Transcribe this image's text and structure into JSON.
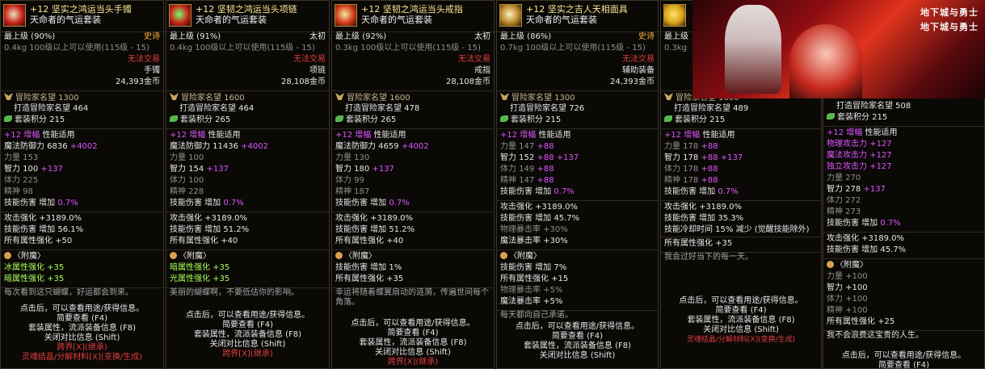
{
  "panels": [
    {
      "id": "bracelet",
      "title": "+12 坚实之鸿运当头手镯",
      "set_name": "天命者的气运套装",
      "grade": "最上级 (90%)",
      "rarity": "史诗",
      "weight": "0.4kg",
      "level_req": "100级以上可以使用(115级 - 15)",
      "trade": "无法交易",
      "slot": "手镯",
      "price": "24,393金币",
      "rep": "冒险家名望 1300",
      "craft_rep": "打造冒险家名望 464",
      "set_score": "套装积分 215",
      "amp_prefix": "+12",
      "amp_label": "增幅",
      "amp_suffix": "性能适用",
      "stats": [
        {
          "t": "魔法防御力 6836 ",
          "v": "+4002"
        },
        {
          "t": "力量 153",
          "v": ""
        },
        {
          "t": "智力 100 ",
          "v": "+137"
        },
        {
          "t": "体力 225",
          "v": ""
        },
        {
          "t": "精神 98",
          "v": ""
        }
      ],
      "skill_dmg": "技能伤害 增加",
      "skill_dmg_pct": "0.7%",
      "effects": [
        "攻击强化 +3189.0%",
        "技能伤害 增加 56.1%",
        "所有属性强化 +50"
      ],
      "enchant": "〈附魔〉",
      "enchant_effects": [
        "冰属性强化 +35",
        "暗属性强化 +35"
      ],
      "flavor": "每次看到这只蝴蝶，好运都会到来。",
      "footer": [
        "点击后，可以查看用途/获得信息。",
        "简要查看 (F4)",
        "套装属性，流派装备信息 (F8)",
        "关闭对比信息 (Shift)",
        "跨界[X](继承)",
        "灵魂结晶/分解材料[X](变换/生成)"
      ]
    },
    {
      "id": "necklace",
      "title": "+12 坚韧之鸿运当头项链",
      "set_name": "天命者的气运套装",
      "grade": "最上级 (91%)",
      "rarity": "太初",
      "weight": "0.4kg",
      "level_req": "100级以上可以使用(115级 - 15)",
      "trade": "无法交易",
      "slot": "项链",
      "price": "28,108金币",
      "rep": "冒险家名望 1600",
      "craft_rep": "打造冒险家名望 464",
      "set_score": "套装积分 265",
      "amp_prefix": "+12",
      "amp_label": "增幅",
      "amp_suffix": "性能适用",
      "stats": [
        {
          "t": "魔法防御力 11436 ",
          "v": "+4002"
        },
        {
          "t": "力量 100",
          "v": ""
        },
        {
          "t": "智力 154 ",
          "v": "+137"
        },
        {
          "t": "体力 100",
          "v": ""
        },
        {
          "t": "精神 228",
          "v": ""
        }
      ],
      "skill_dmg": "技能伤害 增加",
      "skill_dmg_pct": "0.7%",
      "effects": [
        "攻击强化 +3189.0%",
        "技能伤害 增加 51.2%",
        "所有属性强化 +40"
      ],
      "enchant": "〈附魔〉",
      "enchant_effects": [
        "暗属性强化 +35",
        "光属性强化 +35"
      ],
      "flavor": "美丽的蝴蝶啊，不要低估你的影响。",
      "footer": [
        "点击后，可以查看用途/获得信息。",
        "简要查看 (F4)",
        "套装属性，流派装备信息 (F8)",
        "关闭对比信息 (Shift)",
        "跨界[X](继承)"
      ]
    },
    {
      "id": "ring",
      "title": "+12 坚韧之鸿运当头戒指",
      "set_name": "天命者的气运套装",
      "grade": "最上级 (92%)",
      "rarity": "太初",
      "weight": "0.3kg",
      "level_req": "100级以上可以使用(115级 - 15)",
      "trade": "无法交易",
      "slot": "戒指",
      "price": "28,108金币",
      "rep": "冒险家名望 1600",
      "craft_rep": "打造冒险家名望 478",
      "set_score": "套装积分 265",
      "amp_prefix": "+12",
      "amp_label": "增幅",
      "amp_suffix": "性能适用",
      "stats": [
        {
          "t": "魔法防御力 4659 ",
          "v": "+4002"
        },
        {
          "t": "力量 130",
          "v": ""
        },
        {
          "t": "智力 180 ",
          "v": "+137"
        },
        {
          "t": "体力 99",
          "v": ""
        },
        {
          "t": "精神 187",
          "v": ""
        }
      ],
      "skill_dmg": "技能伤害 增加",
      "skill_dmg_pct": "0.7%",
      "effects": [
        "攻击强化 +3189.0%",
        "技能伤害 增加 51.2%",
        "所有属性强化 +40"
      ],
      "enchant": "〈附魔〉",
      "enchant_effects": [
        "技能伤害 增加 1%",
        "所有属性强化 +35"
      ],
      "flavor": "幸运将随着蝶翼扇动的涟漪，传遍世间每个角落。",
      "footer": [
        "点击后，可以查看用途/获得信息。",
        "简要查看 (F4)",
        "套装属性，流派装备信息 (F8)",
        "关闭对比信息 (Shift)",
        "跨界[X](继承)"
      ]
    },
    {
      "id": "support",
      "title": "+12 坚实之吉人天相面具",
      "set_name": "天命者的气运套装",
      "grade": "最上级 (86%)",
      "rarity": "史诗",
      "weight": "0.7kg",
      "level_req": "100级以上可以使用(115级 - 15)",
      "trade": "无法交易",
      "slot": "辅助装备",
      "price": "24,393金币",
      "rep": "冒险家名望 1300",
      "craft_rep": "打造冒险家名望 726",
      "set_score": "套装积分 215",
      "amp_prefix": "+12",
      "amp_label": "增幅",
      "amp_suffix": "性能适用",
      "stats": [
        {
          "t": "力量 147 ",
          "v": "+88"
        },
        {
          "t": "智力 152 ",
          "v": "+88 +137"
        },
        {
          "t": "体力 149 ",
          "v": "+88"
        },
        {
          "t": "精神 147 ",
          "v": "+88"
        }
      ],
      "skill_dmg": "技能伤害 增加",
      "skill_dmg_pct": "0.7%",
      "effects": [
        "攻击强化 +3189.0%",
        "技能伤害 增加 45.7%",
        "物理暴击率 +30%",
        "魔法暴击率 +30%"
      ],
      "enchant": "〈附魔〉",
      "enchant_effects": [
        "技能伤害 增加 7%",
        "所有属性强化 +15",
        "物理暴击率 +5%",
        "魔法暴击率 +5%"
      ],
      "flavor": "每天都向自己承诺。",
      "footer": [
        "点击后，可以查看用途/获得信息。",
        "简要查看 (F4)",
        "套装属性，流派装备信息 (F8)",
        "关闭对比信息 (Shift)"
      ]
    },
    {
      "id": "magic-stone",
      "title": "",
      "set_name": "",
      "grade": "最上级",
      "rarity": "",
      "weight": "0.3kg",
      "level_req": "",
      "trade": "",
      "slot": "",
      "price": "",
      "rep": "冒险家名望 1600",
      "craft_rep": "打造冒险家名望 489",
      "set_score": "套装积分 215",
      "amp_prefix": "+12",
      "amp_label": "增幅",
      "amp_suffix": "性能适用",
      "stats": [
        {
          "t": "力量 178 ",
          "v": "+88"
        },
        {
          "t": "智力 178 ",
          "v": "+88 +137"
        },
        {
          "t": "体力 178 ",
          "v": "+88"
        },
        {
          "t": "精神 178 ",
          "v": "+88"
        }
      ],
      "skill_dmg": "技能伤害 增加",
      "skill_dmg_pct": "0.7%",
      "effects": [
        "攻击强化 +3189.0%",
        "技能伤害 增加 35.3%",
        "技能冷却时间 15% 减少 (觉醒技能除外)"
      ],
      "enchant": "",
      "enchant_effects": [
        "所有属性强化 +35"
      ],
      "flavor": "我会过好当下的每一天。",
      "footer": [
        "点击后，可以查看用途/获得信息。",
        "简要查看 (F4)",
        "套装属性，流派装备信息 (F8)",
        "关闭对比信息 (Shift)",
        "灵魂结晶/分解材料[X](变换/生成)"
      ]
    },
    {
      "id": "earring",
      "title": "",
      "set_name": "",
      "grade": "",
      "rarity": "",
      "weight": "",
      "level_req": "",
      "trade": "",
      "slot": "",
      "price": "",
      "rep": "",
      "craft_rep": "打造冒险家名望 508",
      "set_score": "套装积分 215",
      "amp_prefix": "+12",
      "amp_label": "增幅",
      "amp_suffix": "性能适用",
      "stats": [
        {
          "t": "物理攻击力 ",
          "v": "+127"
        },
        {
          "t": "魔法攻击力 ",
          "v": "+127"
        },
        {
          "t": "独立攻击力 ",
          "v": "+127"
        },
        {
          "t": "力量 270",
          "v": ""
        },
        {
          "t": "智力 278 ",
          "v": "+137"
        },
        {
          "t": "体力 272",
          "v": ""
        },
        {
          "t": "精神 273",
          "v": ""
        }
      ],
      "skill_dmg": "技能伤害 增加",
      "skill_dmg_pct": "0.7%",
      "effects": [
        "攻击强化 +3189.0%",
        "技能伤害 增加 45.7%"
      ],
      "enchant": "〈附魔〉",
      "enchant_effects": [
        "力量 +100",
        "智力 +100",
        "体力 +100",
        "精神 +100",
        "所有属性强化 +25"
      ],
      "flavor": "我不会浪费这宝贵的人生。",
      "footer": [
        "点击后，可以查看用途/获得信息。",
        "简要查看 (F4)"
      ]
    }
  ],
  "banner": {
    "logo_top": "地下城与勇士",
    "logo_bottom": "地下城与勇士"
  }
}
